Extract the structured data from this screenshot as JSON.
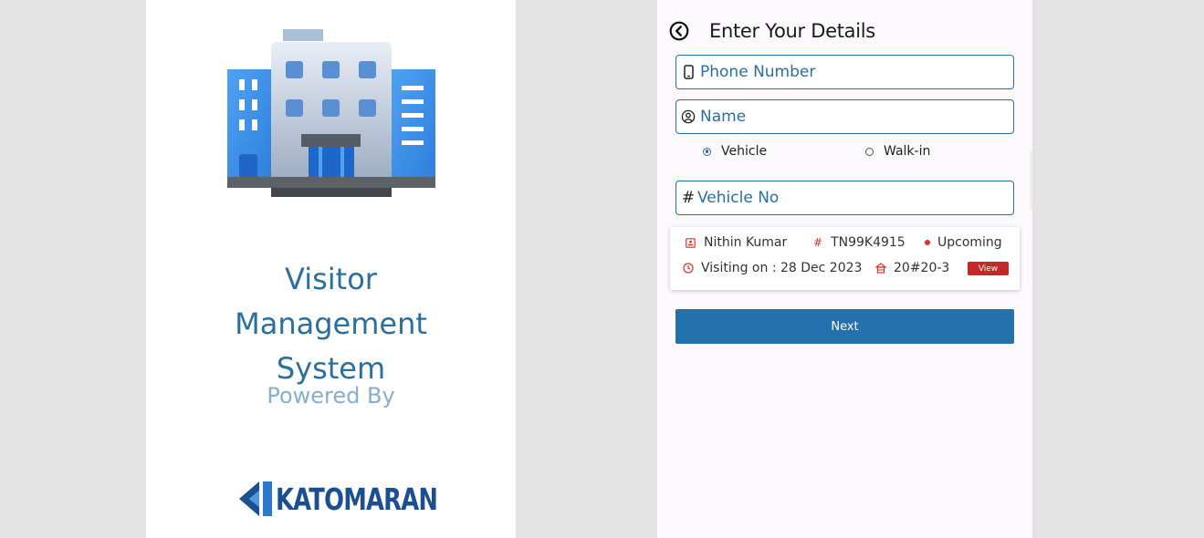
{
  "splash": {
    "title": "Visitor Management System",
    "powered_by": "Powered By",
    "brand_name": "KATOMARAN",
    "building_icon": "office-building-icon"
  },
  "form": {
    "header": {
      "back_icon": "back-arrow-circle-icon",
      "title": "Enter Your Details"
    },
    "phone": {
      "icon": "phone-icon",
      "placeholder": "Phone Number",
      "value": ""
    },
    "name": {
      "icon": "user-circle-icon",
      "placeholder": "Name",
      "value": ""
    },
    "visit_type": {
      "options": [
        "Vehicle",
        "Walk-in"
      ],
      "selected": "Vehicle"
    },
    "vehicle": {
      "icon": "hash-icon",
      "prefix": "#",
      "placeholder": "Vehicle No",
      "value": ""
    },
    "visit_card": {
      "visitor_name": "Nithin Kumar",
      "vehicle_no": "TN99K4915",
      "status": "Upcoming",
      "visiting_on": "Visiting on : 28 Dec 2023",
      "flat": "20#20-3",
      "view_label": "View"
    },
    "next_label": "Next"
  },
  "colors": {
    "primary": "#2a6f9e",
    "button": "#2571ad",
    "danger": "#c62828",
    "status_red": "#d9322c",
    "brand": "#1b4f93"
  }
}
